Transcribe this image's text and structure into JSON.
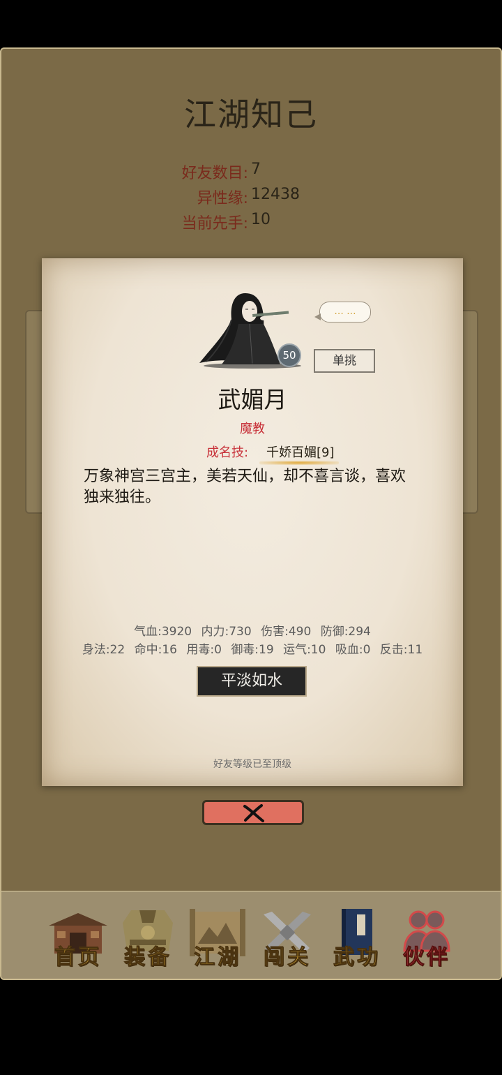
{
  "page": {
    "title": "江湖知己"
  },
  "stats": {
    "friend_count_label": "好友数目:",
    "friend_count_value": "7",
    "charm_label": "异性缘:",
    "charm_value": "12438",
    "initiative_label": "当前先手:",
    "initiative_value": "10"
  },
  "card": {
    "level": "50",
    "speech": "... ...",
    "duel_label": "单挑",
    "name": "武媚月",
    "sect": "魔教",
    "signature_skill_label": "成名技:",
    "signature_skill_value": "千娇百媚[9]",
    "bio": "万象神宫三宫主，美若天仙，却不喜言谈，喜欢独来独往。",
    "attributes_line1": [
      "气血:3920",
      "内力:730",
      "伤害:490",
      "防御:294"
    ],
    "attributes_line2": [
      "身法:22",
      "命中:16",
      "用毒:0",
      "御毒:19",
      "运气:10",
      "吸血:0",
      "反击:11"
    ],
    "mood_label": "平淡如水",
    "friend_note": "好友等级已至顶级"
  },
  "close_icon": "close-x-icon",
  "bottom_nav": {
    "items": [
      {
        "label": "首页",
        "icon": "temple-icon",
        "active": false
      },
      {
        "label": "装备",
        "icon": "armor-icon",
        "active": false
      },
      {
        "label": "江湖",
        "icon": "scroll-map-icon",
        "active": false
      },
      {
        "label": "闯关",
        "icon": "crossed-blades-icon",
        "active": false
      },
      {
        "label": "武功",
        "icon": "book-icon",
        "active": false
      },
      {
        "label": "伙伴",
        "icon": "partners-icon",
        "active": true
      }
    ]
  },
  "colors": {
    "background": "#7b6a47",
    "accent_red": "#c8323a",
    "nav_gold": "#e9b83b",
    "nav_active": "#e05a5a",
    "close_button": "#e07060"
  }
}
